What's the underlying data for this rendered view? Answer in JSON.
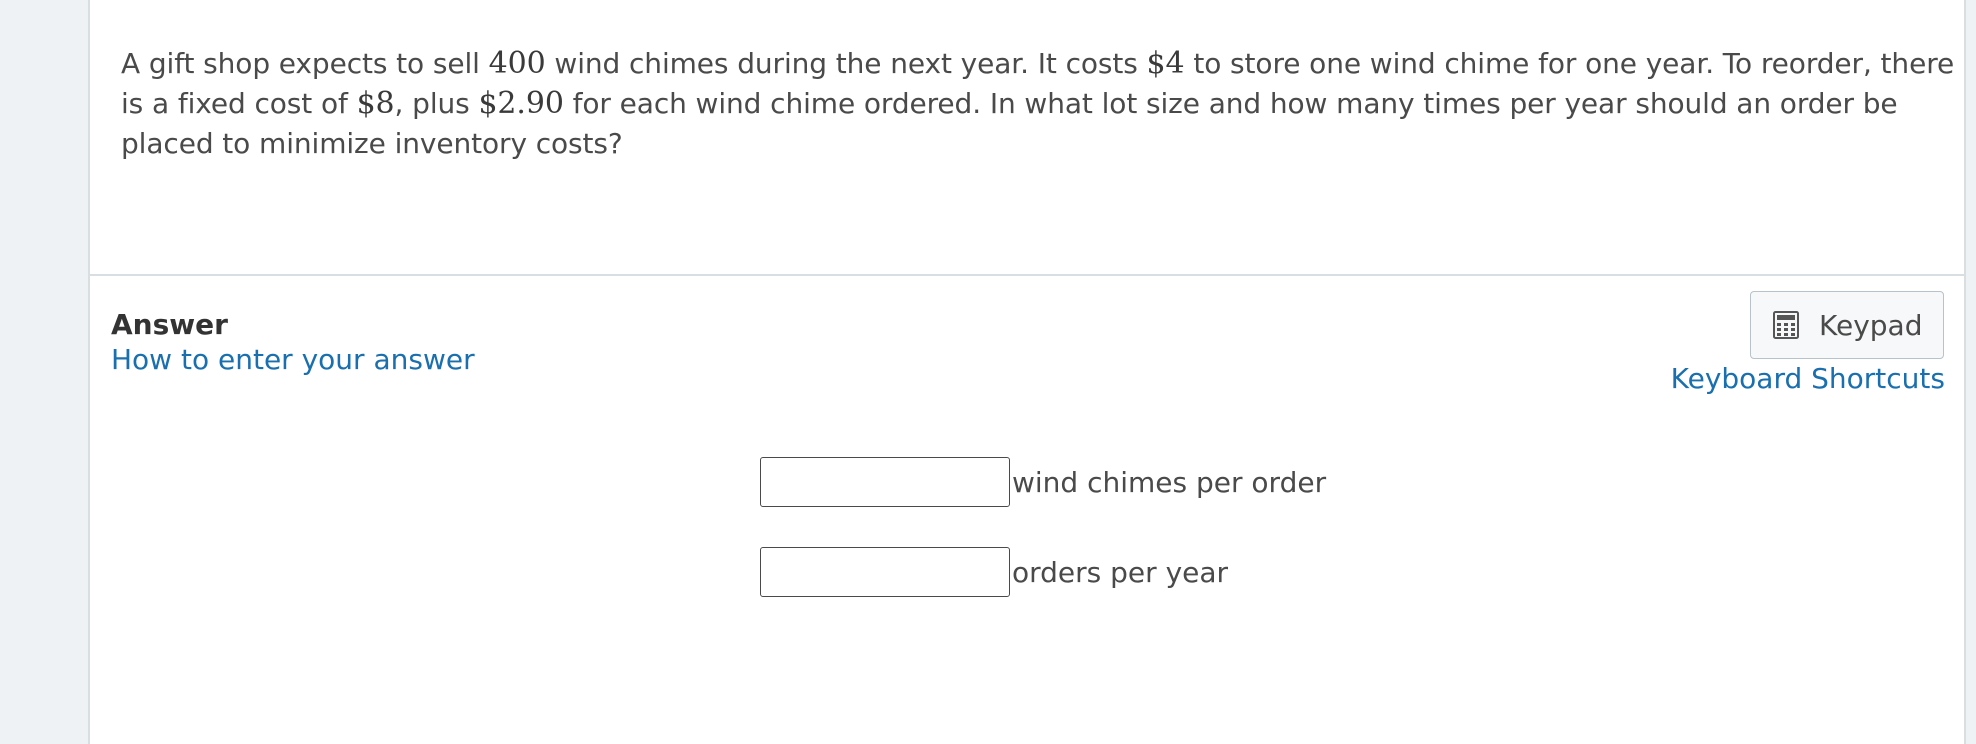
{
  "question": {
    "t1": "A gift shop expects to sell ",
    "n1": "400",
    "t2": " wind chimes during the next year.  It costs ",
    "n2": "$4",
    "t3": " to store one wind chime for one year.  To reorder, there is a fixed cost of ",
    "n3": "$8",
    "t4": ", plus ",
    "n4": "$2.90",
    "t5": " for each wind chime ordered.  In what lot size and how many times per year should an order be placed to minimize inventory costs?"
  },
  "answer": {
    "heading": "Answer",
    "howto_link": "How to enter your answer",
    "keypad_label": "Keypad",
    "keypad_icon": "calculator-icon",
    "shortcuts_link": "Keyboard Shortcuts"
  },
  "fields": [
    {
      "value": "",
      "unit": "wind chimes per order"
    },
    {
      "value": "",
      "unit": "orders per year"
    }
  ],
  "colors": {
    "link": "#1a6faf",
    "text": "#4a4a4a",
    "background": "#eef2f5"
  }
}
